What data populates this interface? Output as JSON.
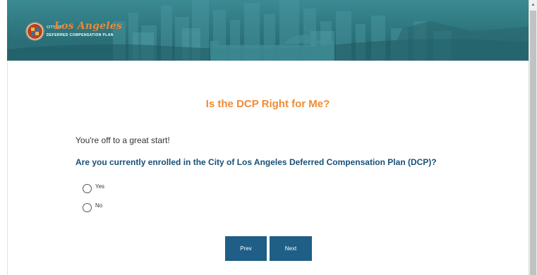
{
  "header": {
    "logo": {
      "city_of": "CITY OF",
      "los_angeles": "Los Angeles",
      "subtitle": "DEFERRED COMPENSATION PLAN",
      "seal_icon": "city-seal-icon"
    },
    "colors": {
      "banner": "#2f7880",
      "accent": "#ef8b34"
    }
  },
  "main": {
    "title": "Is the DCP Right for Me?",
    "intro": "You're off to a great start!",
    "question": "Are you currently enrolled in the City of Los Angeles Deferred Compensation Plan (DCP)?",
    "options": [
      {
        "label": "Yes",
        "selected": false
      },
      {
        "label": "No",
        "selected": false
      }
    ]
  },
  "nav": {
    "prev_label": "Prev",
    "next_label": "Next",
    "button_color": "#1f5e86"
  },
  "scrollbar": {
    "up_icon": "scroll-up-arrow-icon"
  }
}
